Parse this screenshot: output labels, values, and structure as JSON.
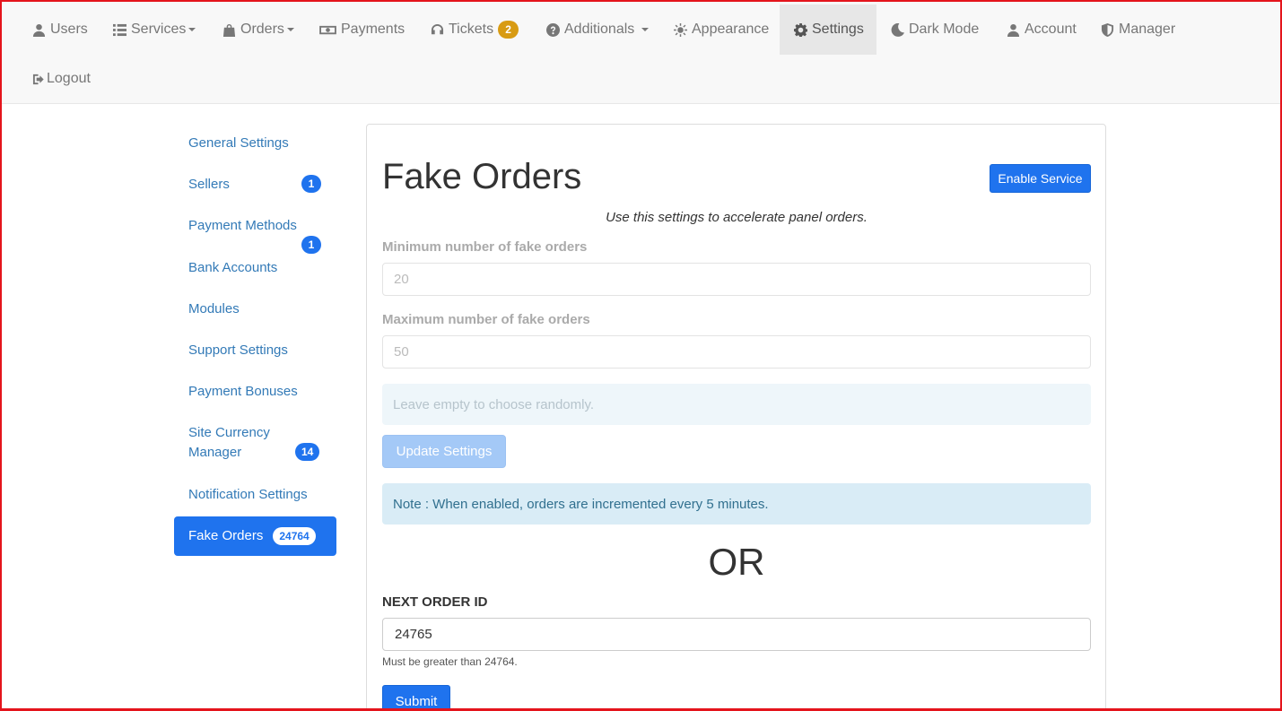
{
  "navbar": {
    "items": [
      {
        "label": "Users",
        "icon": "user-icon"
      },
      {
        "label": "Services",
        "icon": "list-icon"
      },
      {
        "label": "Orders",
        "icon": "bag-icon"
      },
      {
        "label": "Payments",
        "icon": "money-icon"
      },
      {
        "label": "Tickets",
        "icon": "headset-icon",
        "badge": "2"
      },
      {
        "label": "Additionals",
        "icon": "question-circle-icon"
      },
      {
        "label": "Appearance",
        "icon": "sun-icon"
      },
      {
        "label": "Settings",
        "icon": "gear-icon"
      },
      {
        "label": "Dark Mode",
        "icon": "moon-icon"
      },
      {
        "label": "Account",
        "icon": "user-icon"
      },
      {
        "label": "Manager",
        "icon": "shield-icon"
      },
      {
        "label": "Logout",
        "icon": "logout-icon"
      }
    ],
    "active": "Settings"
  },
  "sidebar": {
    "items": [
      {
        "label": "General Settings"
      },
      {
        "label": "Sellers",
        "badge": "1"
      },
      {
        "label": "Payment Methods",
        "badge": "1"
      },
      {
        "label": "Bank Accounts"
      },
      {
        "label": "Modules"
      },
      {
        "label": "Support Settings"
      },
      {
        "label": "Payment Bonuses"
      },
      {
        "label": "Site Currency Manager",
        "badge": "14"
      },
      {
        "label": "Notification Settings"
      },
      {
        "label": "Fake Orders",
        "badge": "24764"
      }
    ],
    "active": "Fake Orders"
  },
  "main": {
    "title": "Fake Orders",
    "enable_button": "Enable Service",
    "subtitle": "Use this settings to accelerate panel orders.",
    "min_label": "Minimum number of fake orders",
    "min_placeholder": "20",
    "max_label": "Maximum number of fake orders",
    "max_placeholder": "50",
    "hint": "Leave empty to choose randomly.",
    "update_button": "Update Settings",
    "note": "Note : When enabled, orders are incremented every 5 minutes.",
    "or_text": "OR",
    "next_label": "NEXT ORDER ID",
    "next_value": "24765",
    "help_text": "Must be greater than 24764.",
    "submit_button": "Submit"
  },
  "colors": {
    "primary": "#1f73ee",
    "frame": "#e4141c",
    "ticket_badge": "#d89b13",
    "note_bg": "#d9ecf6"
  }
}
